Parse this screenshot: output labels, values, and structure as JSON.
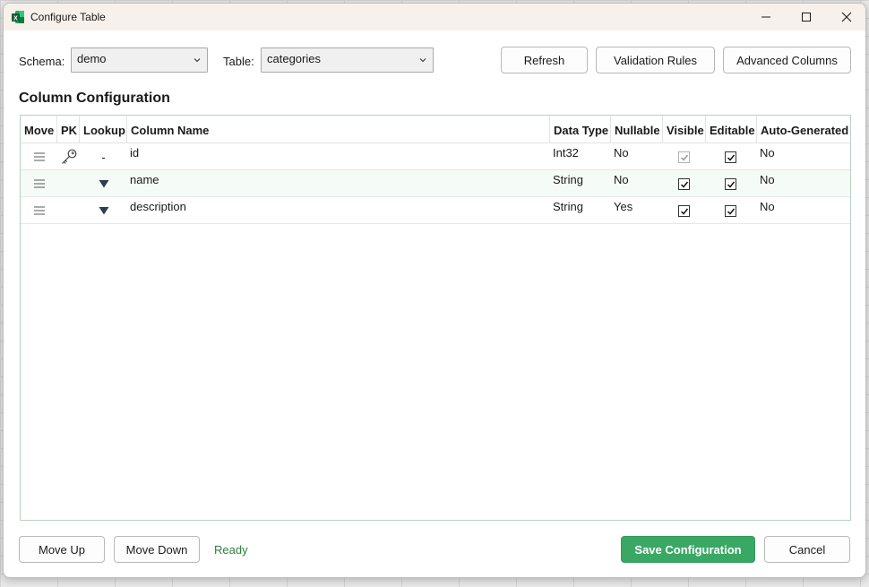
{
  "window": {
    "title": "Configure Table"
  },
  "schema": {
    "label": "Schema:",
    "value": "demo"
  },
  "table": {
    "label": "Table:",
    "value": "categories"
  },
  "toolbar": {
    "refresh": "Refresh",
    "validation_rules": "Validation Rules",
    "advanced_columns": "Advanced Columns"
  },
  "section": {
    "title": "Column Configuration"
  },
  "grid": {
    "headers": {
      "move": "Move",
      "pk": "PK",
      "lookup": "Lookup",
      "column_name": "Column Name",
      "data_type": "Data Type",
      "nullable": "Nullable",
      "visible": "Visible",
      "editable": "Editable",
      "auto_generated": "Auto-Generated"
    },
    "rows": [
      {
        "lookup": "-",
        "column_name": "id",
        "data_type": "Int32",
        "nullable": "No",
        "visible": true,
        "visible_disabled": true,
        "editable": true,
        "auto_generated": "No",
        "pk": true
      },
      {
        "lookup": "",
        "column_name": "name",
        "data_type": "String",
        "nullable": "No",
        "visible": true,
        "visible_disabled": false,
        "editable": true,
        "auto_generated": "No",
        "pk": false
      },
      {
        "lookup": "",
        "column_name": "description",
        "data_type": "String",
        "nullable": "Yes",
        "visible": true,
        "visible_disabled": false,
        "editable": true,
        "auto_generated": "No",
        "pk": false
      }
    ]
  },
  "footer": {
    "move_up": "Move Up",
    "move_down": "Move Down",
    "status": "Ready",
    "save": "Save Configuration",
    "cancel": "Cancel"
  },
  "colors": {
    "accent": "#3aa865",
    "status": "#2e7d3c",
    "titlebar": "#f8f0ea"
  },
  "icons": {
    "app": "excel-icon",
    "pk": "key-icon",
    "move": "drag-handle-icon",
    "lookup": "dropdown-triangle-icon"
  }
}
